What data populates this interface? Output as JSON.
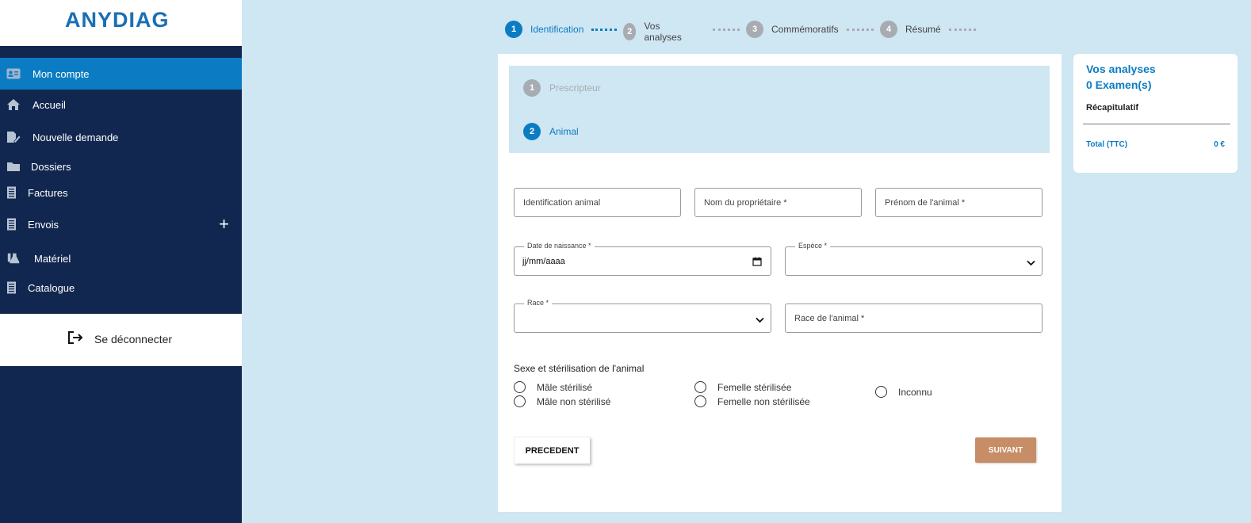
{
  "brand": {
    "logo": "ANYDIAG",
    "color": "#1a6fb5"
  },
  "colors": {
    "sidebar": "#12274f",
    "active": "#0b7cc3",
    "accent_button": "#c78d66",
    "background": "#cfe6f3"
  },
  "sidebar": {
    "items": [
      {
        "label": "Mon compte",
        "icon": "id-card-icon",
        "active": true
      },
      {
        "label": "Accueil",
        "icon": "home-icon"
      },
      {
        "label": "Nouvelle demande",
        "icon": "edit-document-icon"
      },
      {
        "label": "Dossiers",
        "icon": "folder-icon"
      },
      {
        "label": "Factures",
        "icon": "receipt-icon"
      },
      {
        "label": "Envois",
        "icon": "receipt-icon",
        "expand": "+"
      },
      {
        "label": "Matériel",
        "icon": "flask-icon"
      },
      {
        "label": "Catalogue",
        "icon": "receipt-icon"
      }
    ],
    "logout": {
      "label": "Se déconnecter",
      "icon": "logout-icon"
    }
  },
  "stepper": {
    "steps": [
      {
        "num": "1",
        "label": "Identification",
        "active": true
      },
      {
        "num": "2",
        "label": "Vos analyses"
      },
      {
        "num": "3",
        "label": "Commémoratifs"
      },
      {
        "num": "4",
        "label": "Résumé"
      }
    ]
  },
  "substeps": [
    {
      "num": "1",
      "label": "Prescripteur",
      "active": false
    },
    {
      "num": "2",
      "label": "Animal",
      "active": true
    }
  ],
  "form": {
    "identification": {
      "placeholder": "Identification animal"
    },
    "owner_name": {
      "placeholder": "Nom du propriétaire *"
    },
    "animal_firstname": {
      "placeholder": "Prénom de l'animal *"
    },
    "birthdate": {
      "label": "Date de naissance *",
      "value": "jj/mm/aaaa"
    },
    "species": {
      "label": "Espèce *",
      "value": ""
    },
    "race": {
      "label": "Race *",
      "value": ""
    },
    "race_animal": {
      "placeholder": "Race de l'animal *"
    },
    "sex_title": "Sexe et stérilisation de l'animal",
    "sex_options": [
      "Mâle stérilisé",
      "Mâle non stérilisé",
      "Femelle stérilisée",
      "Femelle non stérilisée",
      "Inconnu"
    ],
    "prev_label": "PRECEDENT",
    "next_label": "SUIVANT"
  },
  "summary": {
    "title": "Vos analyses",
    "count": "0 Examen(s)",
    "recap": "Récapitulatif",
    "total_label": "Total (TTC)",
    "total_value": "0 €"
  }
}
